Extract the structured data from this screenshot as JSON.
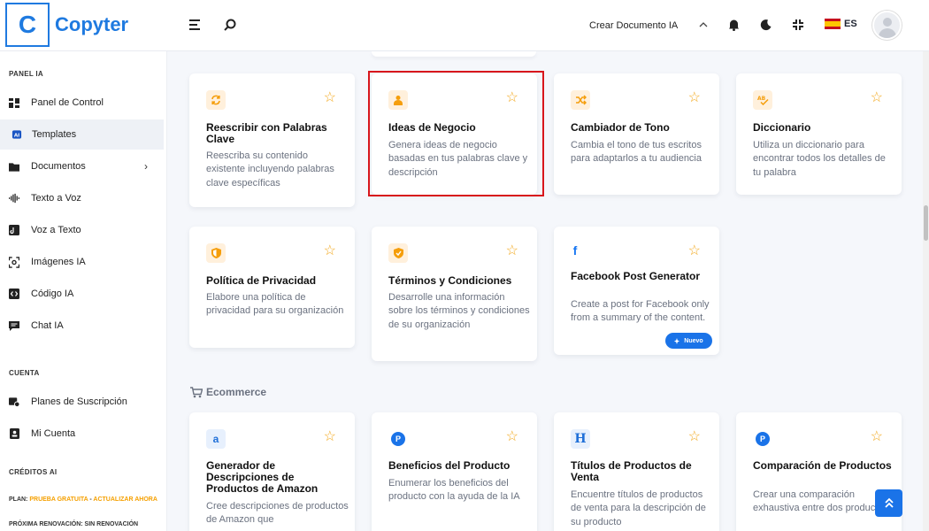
{
  "app": {
    "logo_letter": "C",
    "name": "Copyter"
  },
  "header": {
    "create_doc": "Crear Documento IA",
    "lang": "ES",
    "icons": [
      "menu-icon",
      "search-icon",
      "chevron-up-icon",
      "bell-icon",
      "moon-icon",
      "collapse-icon"
    ]
  },
  "sidebar": {
    "section_ia": "PANEL IA",
    "items": [
      {
        "label": "Panel de Control",
        "icon": "dashboard-icon"
      },
      {
        "label": "Templates",
        "icon": "ai-icon",
        "active": true
      },
      {
        "label": "Documentos",
        "icon": "folder-icon",
        "chevron": "›"
      },
      {
        "label": "Texto a Voz",
        "icon": "waveform-icon"
      },
      {
        "label": "Voz a Texto",
        "icon": "audio-file-icon"
      },
      {
        "label": "Imágenes IA",
        "icon": "image-scan-icon"
      },
      {
        "label": "Código IA",
        "icon": "code-icon"
      },
      {
        "label": "Chat IA",
        "icon": "chat-icon"
      }
    ],
    "section_cuenta": "CUENTA",
    "account_items": [
      {
        "label": "Planes de Suscripción",
        "icon": "subscription-icon"
      },
      {
        "label": "Mi Cuenta",
        "icon": "account-icon"
      }
    ],
    "section_creditos": "CRÉDITOS AI",
    "plan_prefix": "PLAN: ",
    "plan_name": "PRUEBA GRATUITA",
    "plan_separator": " - ",
    "plan_upgrade": "ACTUALIZAR AHORA",
    "renewal": "PRÓXIMA RENOVACIÓN: SIN RENOVACIÓN"
  },
  "cards_row1": [
    {
      "title": "Reescribir con Palabras Clave",
      "desc": "Reescriba su contenido existente incluyendo palabras clave específicas",
      "icon": "refresh-icon"
    },
    {
      "title": "Ideas de Negocio",
      "desc": "Genera ideas de negocio basadas en tus palabras clave y descripción",
      "icon": "businessman-icon"
    },
    {
      "title": "Cambiador de Tono",
      "desc": "Cambia el tono de tus escritos para adaptarlos a tu audiencia",
      "icon": "shuffle-icon"
    },
    {
      "title": "Diccionario",
      "desc": "Utiliza un diccionario para encontrar todos los detalles de tu palabra",
      "icon": "spellcheck-icon"
    }
  ],
  "cards_row2": [
    {
      "title": "Política de Privacidad",
      "desc": "Elabore una política de privacidad para su organización",
      "icon": "shield-icon"
    },
    {
      "title": "Términos y Condiciones",
      "desc": "Desarrolle una información sobre los términos y condiciones de su organización",
      "icon": "shield-check-icon"
    },
    {
      "title": "Facebook Post Generator",
      "desc": "Create a post for Facebook only from a summary of the content.",
      "icon": "facebook-icon",
      "badge": "Nuevo"
    }
  ],
  "ecommerce": {
    "heading": "Ecommerce",
    "cards": [
      {
        "title": "Generador de Descripciones de Productos de Amazon",
        "desc": "Cree descripciones de productos de Amazon que",
        "icon": "amazon-icon",
        "icon_text": "a"
      },
      {
        "title": "Beneficios del Producto",
        "desc": "Enumerar los beneficios del producto con la ayuda de la IA",
        "icon": "product-p-icon",
        "icon_text": "P"
      },
      {
        "title": "Títulos de Productos de Venta",
        "desc": "Encuentre títulos de productos de venta para la descripción de su producto",
        "icon": "heading-icon",
        "icon_text": "H"
      },
      {
        "title": "Comparación de Productos",
        "desc": "Crear una comparación exhaustiva entre dos productos",
        "icon": "compare-p-icon",
        "icon_text": "P"
      }
    ]
  },
  "colors": {
    "accent": "#1a73e8",
    "brand": "#1f7ae0",
    "star": "#f2a81d",
    "highlight": "#d8161c"
  }
}
